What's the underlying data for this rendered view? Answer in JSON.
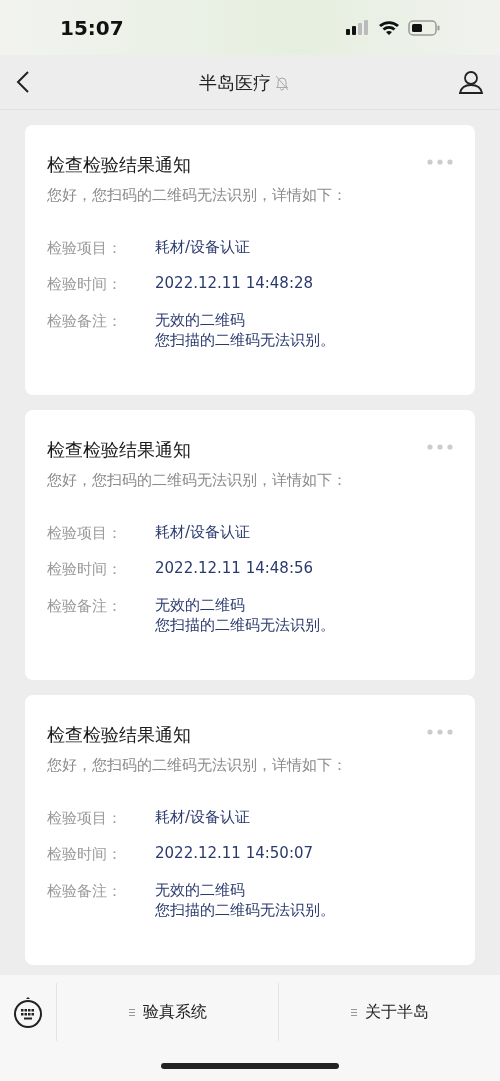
{
  "status_bar": {
    "time": "15:07"
  },
  "header": {
    "title": "半岛医疗",
    "muted": true
  },
  "messages": [
    {
      "title": "检查检验结果通知",
      "intro": "您好，您扫码的二维码无法识别，详情如下：",
      "fields": [
        {
          "label": "检验项目：",
          "value": [
            "耗材/设备认证"
          ]
        },
        {
          "label": "检验时间：",
          "value": [
            "2022.12.11 14:48:28"
          ]
        },
        {
          "label": "检验备注：",
          "value": [
            "无效的二维码",
            "您扫描的二维码无法识别。"
          ]
        }
      ]
    },
    {
      "title": "检查检验结果通知",
      "intro": "您好，您扫码的二维码无法识别，详情如下：",
      "fields": [
        {
          "label": "检验项目：",
          "value": [
            "耗材/设备认证"
          ]
        },
        {
          "label": "检验时间：",
          "value": [
            "2022.12.11 14:48:56"
          ]
        },
        {
          "label": "检验备注：",
          "value": [
            "无效的二维码",
            "您扫描的二维码无法识别。"
          ]
        }
      ]
    },
    {
      "title": "检查检验结果通知",
      "intro": "您好，您扫码的二维码无法识别，详情如下：",
      "fields": [
        {
          "label": "检验项目：",
          "value": [
            "耗材/设备认证"
          ]
        },
        {
          "label": "检验时间：",
          "value": [
            "2022.12.11 14:50:07"
          ]
        },
        {
          "label": "检验备注：",
          "value": [
            "无效的二维码",
            "您扫描的二维码无法识别。"
          ]
        }
      ]
    }
  ],
  "bottom_menu": [
    {
      "label": "验真系统"
    },
    {
      "label": "关于半岛"
    }
  ]
}
